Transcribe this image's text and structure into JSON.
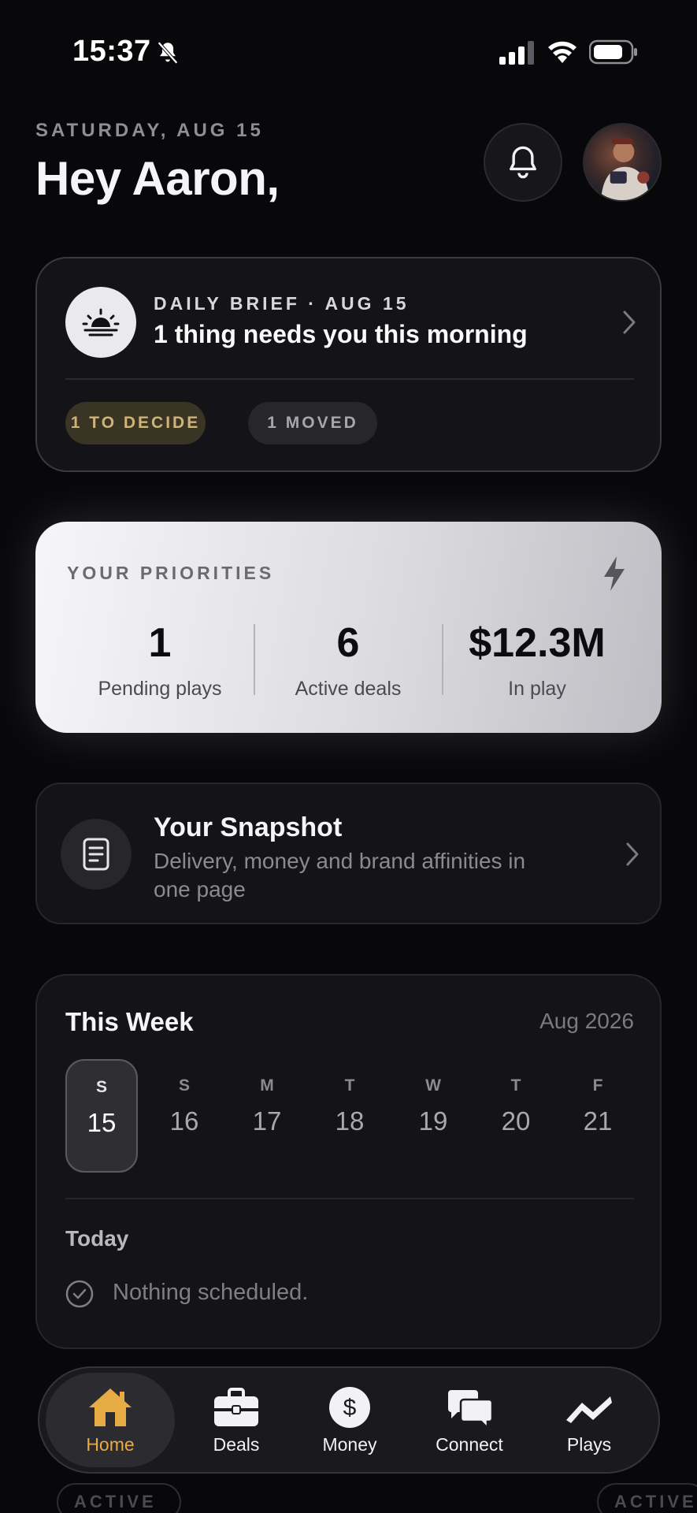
{
  "status_bar": {
    "time": "15:37"
  },
  "header": {
    "date": "SATURDAY, AUG 15",
    "greeting": "Hey Aaron,"
  },
  "daily_brief": {
    "kicker": "DAILY BRIEF · AUG 15",
    "title": "1 thing needs you this morning",
    "pills": [
      "1 TO DECIDE",
      "1 MOVED"
    ]
  },
  "priorities": {
    "label": "YOUR PRIORITIES",
    "stats": [
      {
        "value": "1",
        "label": "Pending plays"
      },
      {
        "value": "6",
        "label": "Active deals"
      },
      {
        "value": "$12.3M",
        "label": "In play"
      }
    ]
  },
  "snapshot": {
    "title": "Your Snapshot",
    "description": "Delivery, money and brand affinities in one page"
  },
  "week": {
    "title": "This Week",
    "month": "Aug 2026",
    "days": [
      {
        "letter": "S",
        "num": "15",
        "selected": true
      },
      {
        "letter": "S",
        "num": "16"
      },
      {
        "letter": "M",
        "num": "17"
      },
      {
        "letter": "T",
        "num": "18"
      },
      {
        "letter": "W",
        "num": "19"
      },
      {
        "letter": "T",
        "num": "20"
      },
      {
        "letter": "F",
        "num": "21"
      }
    ],
    "today_label": "Today",
    "empty_text": "Nothing scheduled."
  },
  "background_peek": {
    "badge_1": "ACTIVE",
    "badge_2": "ACTIVE"
  },
  "tabbar": {
    "items": [
      {
        "label": "Home",
        "icon": "home-icon",
        "active": true
      },
      {
        "label": "Deals",
        "icon": "briefcase-icon"
      },
      {
        "label": "Money",
        "icon": "dollar-icon"
      },
      {
        "label": "Connect",
        "icon": "chat-bubbles-icon"
      },
      {
        "label": "Plays",
        "icon": "trend-icon"
      }
    ]
  },
  "colors": {
    "accent": "#e7ab45",
    "background": "#08080a",
    "card": "#141418"
  }
}
